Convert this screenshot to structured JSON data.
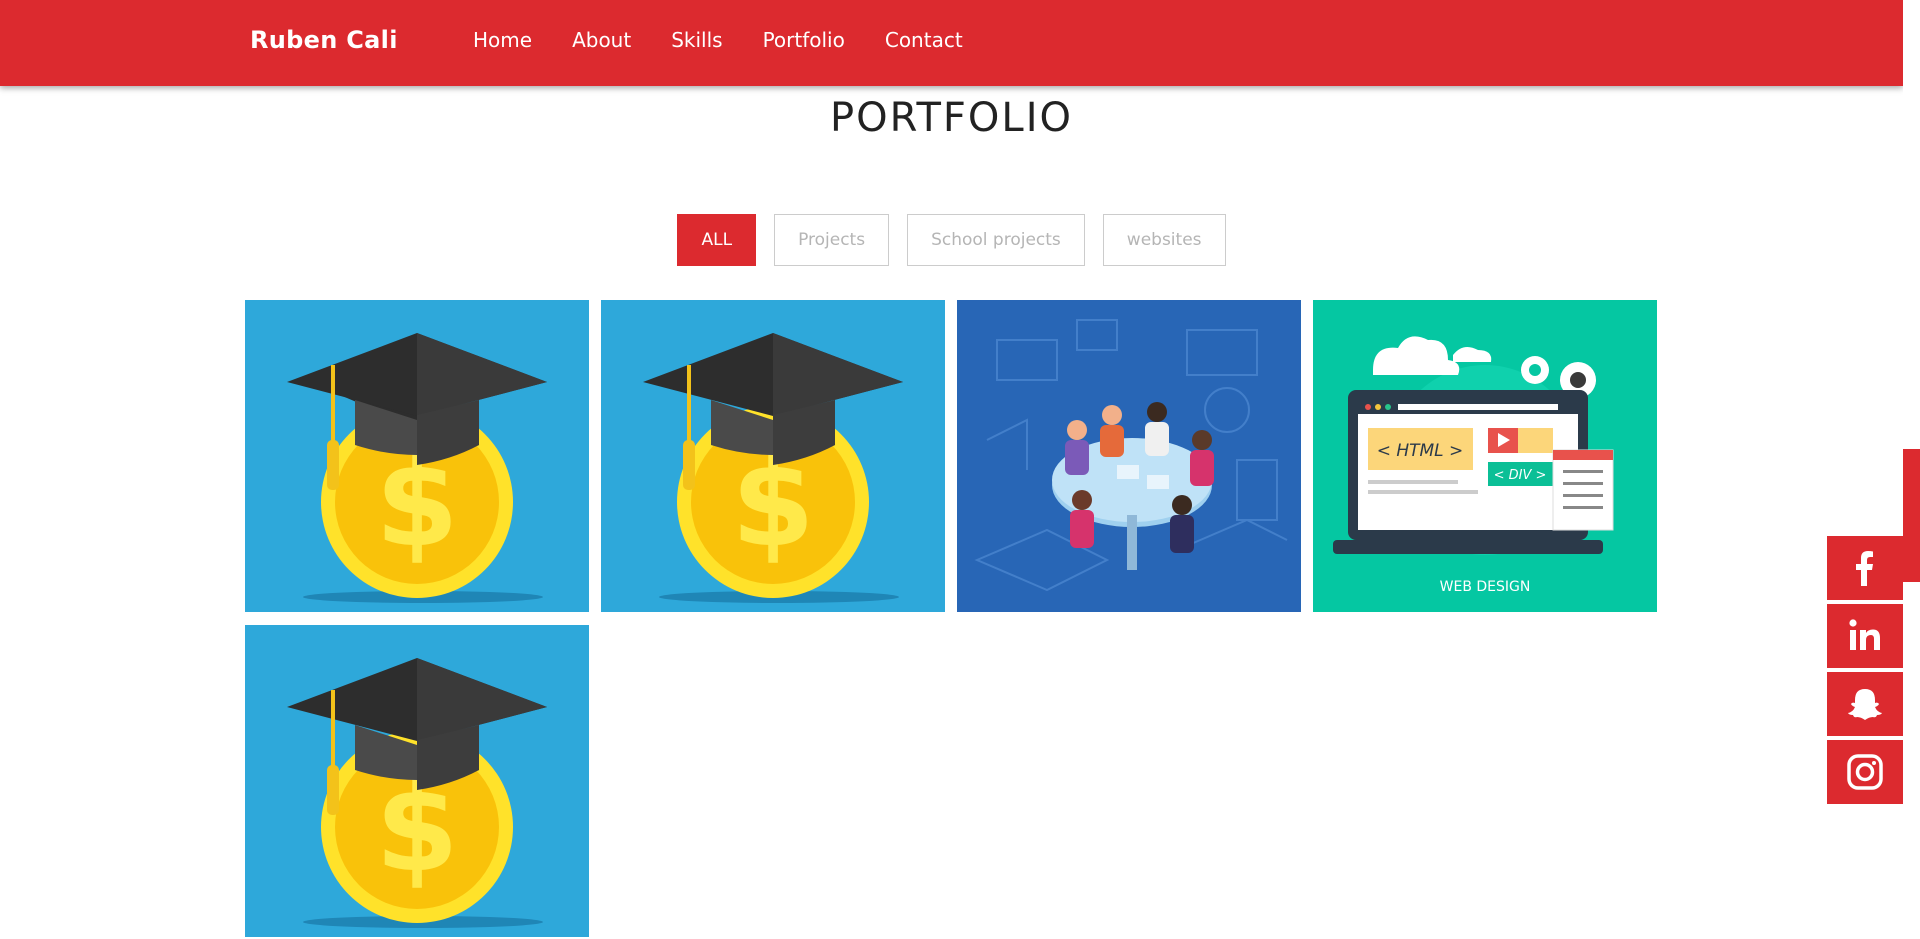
{
  "brand": "Ruben Cali",
  "nav": {
    "items": [
      "Home",
      "About",
      "Skills",
      "Portfolio",
      "Contact"
    ]
  },
  "page_title": "PORTFOLIO",
  "filters": {
    "items": [
      "ALL",
      "Projects",
      "School projects",
      "websites"
    ],
    "active": "ALL"
  },
  "portfolio": {
    "items": [
      {
        "type": "graduation-coin",
        "bg": "#2ea8da"
      },
      {
        "type": "graduation-coin",
        "bg": "#2ea8da"
      },
      {
        "type": "team-meeting",
        "bg": "#2866b6"
      },
      {
        "type": "web-design",
        "bg": "#05c7a2",
        "caption": "WEB DESIGN"
      },
      {
        "type": "graduation-coin",
        "bg": "#2ea8da"
      }
    ]
  },
  "social": {
    "items": [
      "facebook-icon",
      "linkedin-icon",
      "snapchat-icon",
      "instagram-icon"
    ]
  },
  "colors": {
    "accent": "#dc2a2f",
    "text": "#222222"
  }
}
